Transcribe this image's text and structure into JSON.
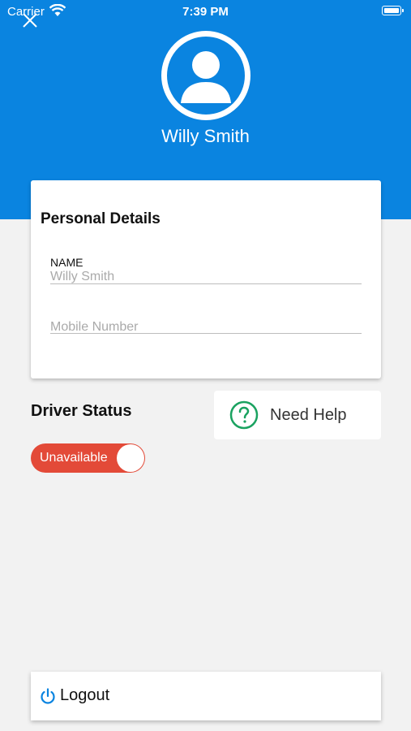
{
  "status_bar": {
    "carrier": "Carrier",
    "time": "7:39 PM"
  },
  "header": {
    "user_name": "Willy Smith",
    "background_color": "#0a84e0"
  },
  "personal_details": {
    "title": "Personal Details",
    "name_label": "NAME",
    "name_value": "Willy Smith",
    "mobile_placeholder": "Mobile Number"
  },
  "driver_status": {
    "title": "Driver Status",
    "toggle_label": "Unavailable",
    "toggle_color": "#e34a38"
  },
  "help": {
    "label": "Need Help",
    "icon_color": "#1aa260"
  },
  "logout": {
    "label": "Logout",
    "icon_color": "#0a84e0"
  }
}
